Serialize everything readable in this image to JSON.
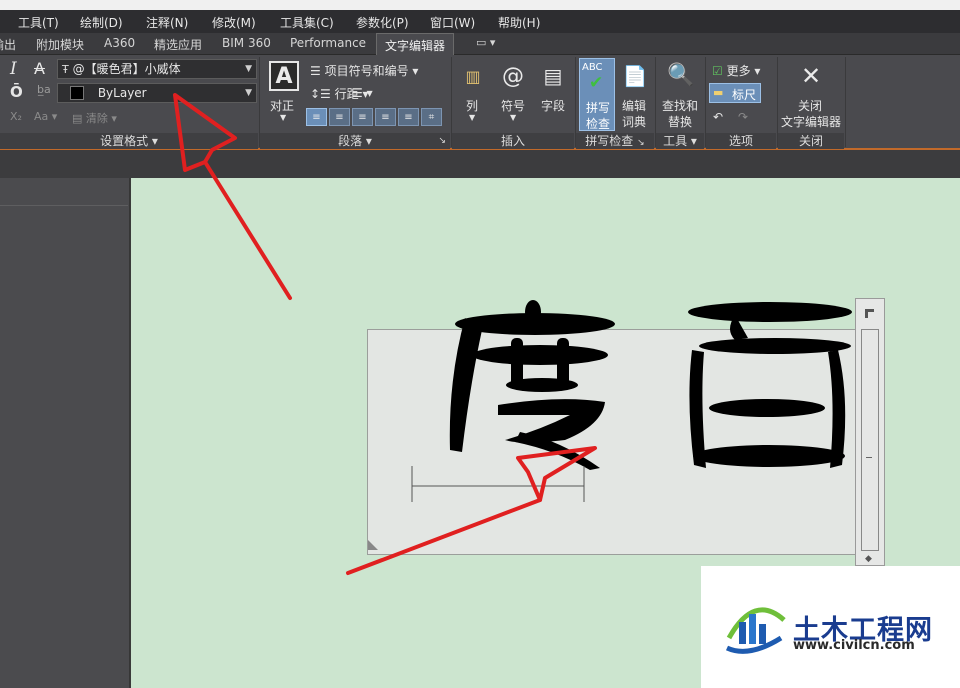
{
  "menu": [
    "工具(T)",
    "绘制(D)",
    "注释(N)",
    "修改(M)",
    "工具集(C)",
    "参数化(P)",
    "窗口(W)",
    "帮助(H)"
  ],
  "tabs": [
    "输出",
    "附加模块",
    "A360",
    "精选应用",
    "BIM 360",
    "Performance",
    "文字编辑器"
  ],
  "active_tab": "文字编辑器",
  "ribbon": {
    "style_panel": {
      "font_value": "@【暖色君】小威体",
      "color_value": "ByLayer",
      "clear_label": "清除",
      "label": "设置格式"
    },
    "paragraph_panel": {
      "justify_label": "对正",
      "bullets_label": "项目符号和编号",
      "line_spacing_label": "行距",
      "label": "段落"
    },
    "insert_panel": {
      "columns_label": "列",
      "symbol_label": "符号",
      "field_label": "字段",
      "label": "插入"
    },
    "spell_panel": {
      "spell_check_line1": "拼写",
      "spell_check_line2": "检查",
      "dictionary_line1": "编辑",
      "dictionary_line2": "词典",
      "label": "拼写检查"
    },
    "tools_panel": {
      "find_line1": "查找和",
      "find_line2": "替换",
      "label": "工具"
    },
    "options_panel": {
      "more_label": "更多",
      "ruler_label": "标尺",
      "label": "选项"
    },
    "close_panel": {
      "close_line1": "关闭",
      "close_line2": "文字编辑器",
      "label": "关闭"
    }
  },
  "canvas": {
    "text_content": "度百"
  },
  "watermark": {
    "title": "土木工程网",
    "url": "www.civilcn.com"
  },
  "colors": {
    "ribbon_bg": "#4a4a4e",
    "canvas_bg": "#cce5cf",
    "arrow": "#e02020",
    "accent": "#c26a2a"
  }
}
